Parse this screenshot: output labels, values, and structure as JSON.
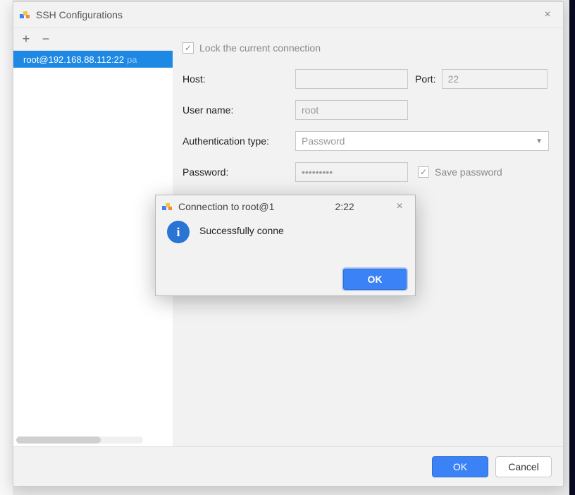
{
  "window": {
    "title": "SSH Configurations",
    "close_tooltip": "Close"
  },
  "sidebar": {
    "add_tooltip": "Add",
    "remove_tooltip": "Remove",
    "items": [
      {
        "label": "root@192.168.88.112:22",
        "extra": "pa",
        "selected": true
      }
    ]
  },
  "form": {
    "lock_label": "Lock the current connection",
    "lock_checked": true,
    "host_label": "Host:",
    "host_value": "",
    "port_label": "Port:",
    "port_value": "22",
    "user_label": "User name:",
    "user_value": "root",
    "auth_label": "Authentication type:",
    "auth_value": "Password",
    "password_label": "Password:",
    "password_value": "•••••••••",
    "save_password_label": "Save password",
    "save_password_checked": true
  },
  "footer": {
    "ok_label": "OK",
    "cancel_label": "Cancel"
  },
  "inner_dialog": {
    "title_prefix": "Connection to root@1",
    "title_suffix": "2:22",
    "message_prefix": "Successfully conne",
    "message_suffix": "",
    "ok_label": "OK"
  }
}
